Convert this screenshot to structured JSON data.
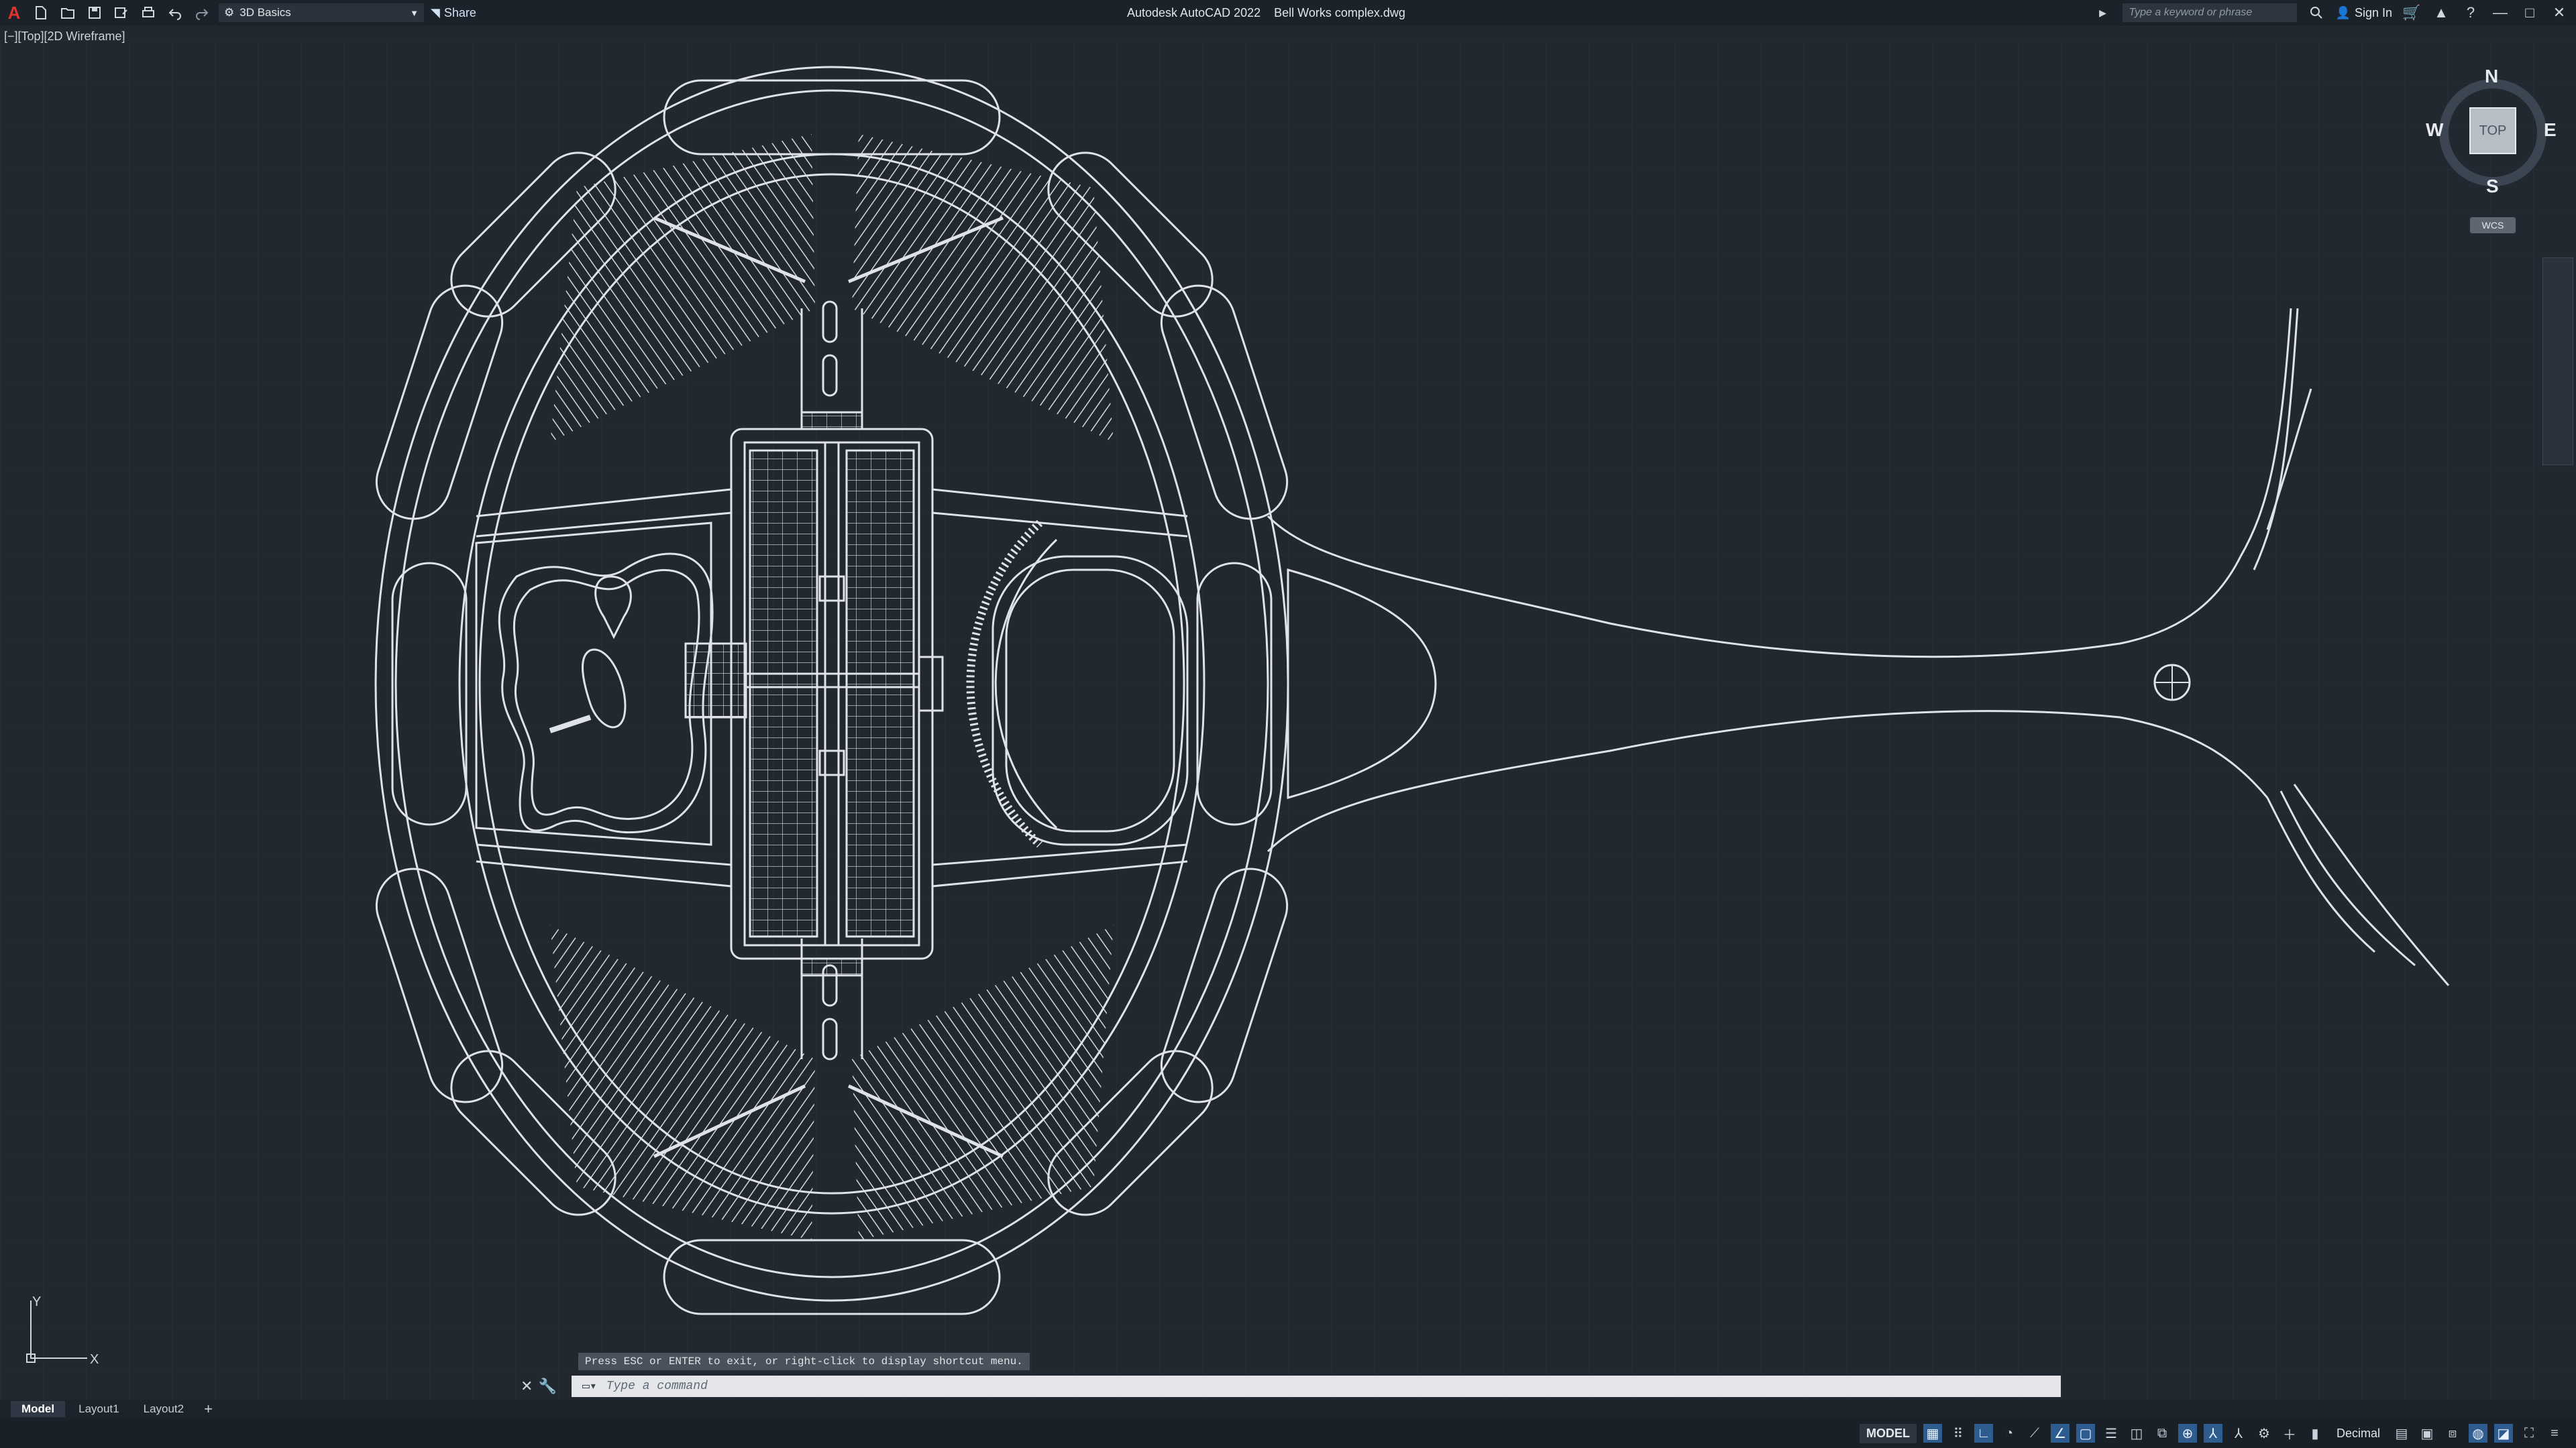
{
  "app": {
    "logo": "A",
    "title": "Autodesk AutoCAD 2022",
    "file": "Bell Works complex.dwg"
  },
  "toolbar": {
    "workspace": "3D Basics",
    "share_label": "Share",
    "icons": [
      "new-icon",
      "open-icon",
      "save-icon",
      "save-as-icon",
      "plot-icon",
      "undo-icon",
      "redo-icon"
    ]
  },
  "header_right": {
    "search_placeholder": "Type a keyword or phrase",
    "sign_in": "Sign In"
  },
  "viewport": {
    "label": "[−][Top][2D Wireframe]"
  },
  "viewcube": {
    "top_face": "TOP",
    "north": "N",
    "south": "S",
    "east": "E",
    "west": "W",
    "wcs": "WCS"
  },
  "ucs": {
    "x_label": "X",
    "y_label": "Y"
  },
  "command": {
    "hint": "Press ESC or ENTER to exit, or right-click to display shortcut menu.",
    "placeholder": "Type a command"
  },
  "tabs": [
    {
      "label": "Model",
      "active": true
    },
    {
      "label": "Layout1",
      "active": false
    },
    {
      "label": "Layout2",
      "active": false
    }
  ],
  "tabs_add": "+",
  "status": {
    "model": "MODEL",
    "units": "Decimal"
  },
  "colors": {
    "background": "#212830",
    "linework": "#dfe3e8",
    "accent": "#2f5c8f"
  }
}
